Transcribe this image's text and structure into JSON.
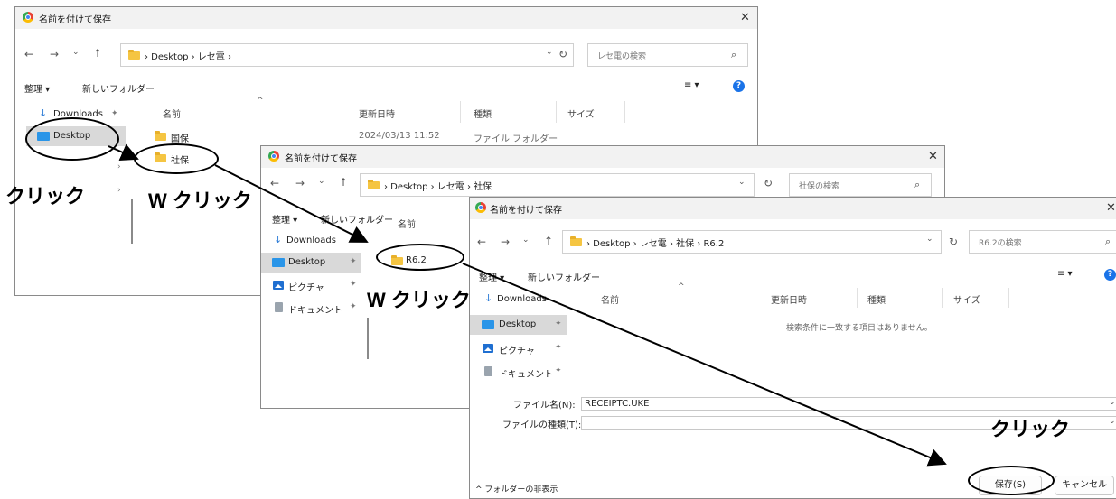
{
  "dialog1": {
    "title": "名前を付けて保存",
    "breadcrumb": "› Desktop › レセ電 ›",
    "search_placeholder": "レセ電の検索",
    "toolbar": {
      "organize": "整理 ▾",
      "new_folder": "新しいフォルダー"
    },
    "nav": [
      "Downloads",
      "Desktop"
    ],
    "columns": {
      "name": "名前",
      "modified": "更新日時",
      "type": "種類",
      "size": "サイズ"
    },
    "rows": [
      {
        "name": "国保",
        "modified": "2024/03/13 11:52",
        "type": "ファイル フォルダー"
      },
      {
        "name": "社保"
      }
    ]
  },
  "dialog2": {
    "title": "名前を付けて保存",
    "breadcrumb": "› Desktop › レセ電 › 社保",
    "search_placeholder": "社保の検索",
    "toolbar": {
      "organize": "整理 ▾",
      "new_folder": "新しいフォルダー"
    },
    "nav": [
      "Downloads",
      "Desktop",
      "ピクチャ",
      "ドキュメント"
    ],
    "columns": {
      "name": "名前"
    },
    "rows": [
      {
        "name": "R6.2"
      }
    ]
  },
  "dialog3": {
    "title": "名前を付けて保存",
    "breadcrumb": "› Desktop › レセ電 › 社保 › R6.2",
    "search_placeholder": "R6.2の検索",
    "toolbar": {
      "organize": "整理 ▾",
      "new_folder": "新しいフォルダー"
    },
    "nav": [
      "Downloads",
      "Desktop",
      "ピクチャ",
      "ドキュメント"
    ],
    "columns": {
      "name": "名前",
      "modified": "更新日時",
      "type": "種類",
      "size": "サイズ"
    },
    "empty_message": "検索条件に一致する項目はありません。",
    "filename_label": "ファイル名(N):",
    "filename_value": "RECEIPTC.UKE",
    "filetype_label": "ファイルの種類(T):",
    "hide_folders": "^ フォルダーの非表示",
    "save_button": "保存(S)",
    "cancel_button": "キャンセル"
  },
  "annotations": {
    "click1": "クリック",
    "wclick1": "W クリック",
    "wclick2": "W クリック",
    "click2": "クリック"
  },
  "icons": [
    "back-arrow-icon",
    "forward-arrow-icon",
    "chevron-down-icon",
    "up-arrow-icon",
    "refresh-icon",
    "search-icon",
    "view-icon",
    "help-icon",
    "close-icon",
    "pin-icon",
    "folder-icon"
  ]
}
